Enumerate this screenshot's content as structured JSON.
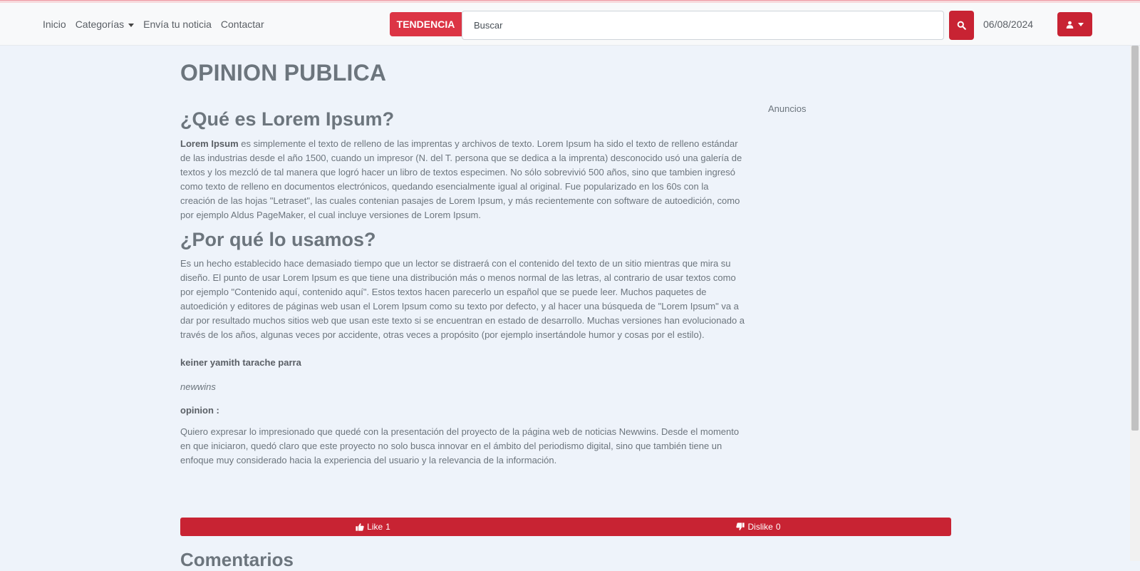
{
  "nav": {
    "links": [
      "Inicio",
      "Categorías",
      "Envía tu noticia",
      "Contactar"
    ],
    "trending_label": "TENDENCIA",
    "search_placeholder": "Buscar",
    "date": "06/08/2024",
    "icons": {
      "search": "search-icon",
      "user": "user-icon",
      "dropdown": "chevron-down-icon"
    },
    "accent_color": "#dc3545"
  },
  "article": {
    "page_title": "OPINION PUBLICA",
    "sections": [
      {
        "heading": "¿Qué es Lorem Ipsum?",
        "lead_bold": "Lorem Ipsum",
        "lines": [
          " es simplemente el texto de relleno de las imprentas y archivos de texto. Lorem Ipsum ha sido el texto de relleno estándar",
          "de las industrias desde el año 1500, cuando un impresor (N. del T. persona que se dedica a la imprenta) desconocido usó una galería de",
          "textos y los mezcló de tal manera que logró hacer un libro de textos especimen. No sólo sobrevivió 500 años, sino que tambien ingresó",
          "como texto de relleno en documentos electrónicos, quedando esencialmente igual al original. Fue popularizado en los 60s con la",
          "creación de las hojas \"Letraset\", las cuales contenian pasajes de Lorem Ipsum, y más recientemente con software de autoedición, como",
          "por ejemplo Aldus PageMaker, el cual incluye versiones de Lorem Ipsum."
        ]
      },
      {
        "heading": "¿Por qué lo usamos?",
        "lines": [
          "Es un hecho establecido hace demasiado tiempo que un lector se distraerá con el contenido del texto de un sitio mientras que mira su",
          "diseño. El punto de usar Lorem Ipsum es que tiene una distribución más o menos normal de las letras, al contrario de usar textos como",
          "por ejemplo \"Contenido aquí, contenido aquí\". Estos textos hacen parecerlo un español que se puede leer. Muchos paquetes de",
          "autoedición y editores de páginas web usan el Lorem Ipsum como su texto por defecto, y al hacer una búsqueda de \"Lorem Ipsum\" va a",
          "dar por resultado muchos sitios web que usan este texto si se encuentran en estado de desarrollo. Muchas versiones han evolucionado a",
          "través de los años, algunas veces por accidente, otras veces a propósito (por ejemplo insertándole humor y cosas por el estilo)."
        ]
      }
    ],
    "author": "keiner yamith tarache parra",
    "source": "newwins",
    "opinion_label": "opinion :",
    "opinion_lines": [
      "Quiero expresar lo impresionado que quedé con la presentación del proyecto de la página web de noticias Newwins. Desde el momento",
      "en que iniciaron, quedó claro que este proyecto no solo busca innovar en el ámbito del periodismo digital, sino que también tiene un",
      "enfoque muy considerado hacia la experiencia del usuario y la relevancia de la información."
    ]
  },
  "sidebar": {
    "ads_label": "Anuncios"
  },
  "reactions": {
    "like_label": "Like",
    "like_count": "1",
    "dislike_label": "Dislike",
    "dislike_count": "0"
  },
  "comments": {
    "title": "Comentarios"
  }
}
